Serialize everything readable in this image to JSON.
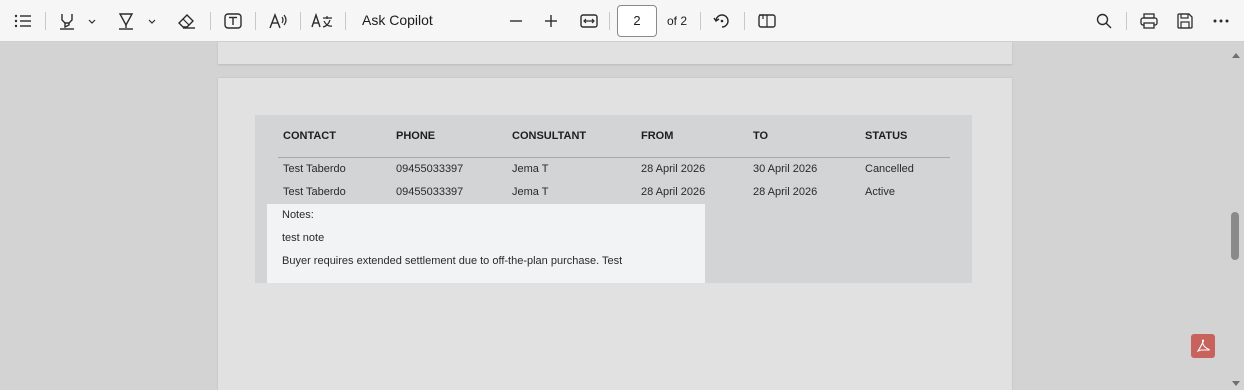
{
  "toolbar": {
    "ask_copilot": "Ask Copilot",
    "page_number": "2",
    "page_total": "of 2",
    "icons": [
      "contents-icon",
      "highlight-icon",
      "chevron-down-icon",
      "draw-icon",
      "chevron-down-icon",
      "eraser-icon",
      "text-box-icon",
      "read-aloud-icon",
      "translate-icon",
      "zoom-out-icon",
      "zoom-in-icon",
      "fit-width-icon",
      "rotate-icon",
      "page-view-icon",
      "search-icon",
      "print-icon",
      "save-icon",
      "more-options-icon"
    ]
  },
  "table": {
    "headers": [
      "CONTACT",
      "PHONE",
      "CONSULTANT",
      "FROM",
      "TO",
      "STATUS"
    ],
    "rows": [
      [
        "Test Taberdo",
        "09455033397",
        "Jema T",
        "28 April 2026",
        "30 April 2026",
        "Cancelled"
      ],
      [
        "Test Taberdo",
        "09455033397",
        "Jema T",
        "28 April 2026",
        "28 April 2026",
        "Active"
      ]
    ]
  },
  "notes": {
    "label": "Notes:",
    "lines": [
      "test note",
      "Buyer requires extended settlement due to off-the-plan purchase. Test"
    ]
  },
  "colors": {
    "toolbar_bg": "#f6f6f6",
    "viewer_bg": "#d3d3d3",
    "page_bg": "#e1e1e1",
    "table_bg": "#d3d4d6",
    "notes_bg": "#f2f3f5",
    "acrobat_badge": "#c8625c"
  }
}
